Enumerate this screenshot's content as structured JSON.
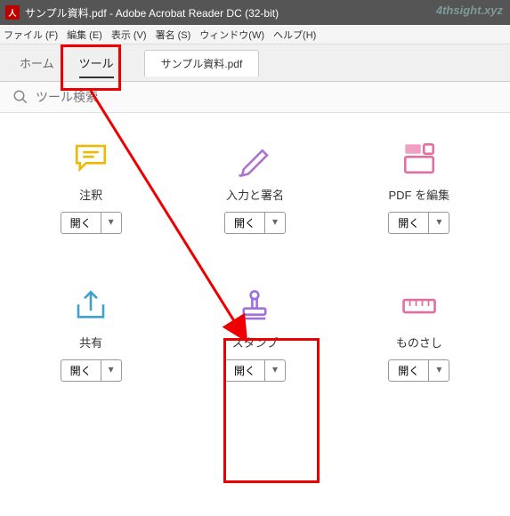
{
  "titlebar": {
    "text": "サンプル資料.pdf - Adobe Acrobat Reader DC (32-bit)"
  },
  "watermark": "4thsight.xyz",
  "menubar": {
    "file": "ファイル (F)",
    "edit": "編集 (E)",
    "view": "表示 (V)",
    "sign": "署名 (S)",
    "window": "ウィンドウ(W)",
    "help": "ヘルプ(H)"
  },
  "tabs": {
    "home": "ホーム",
    "tools": "ツール",
    "doc": "サンプル資料.pdf"
  },
  "search": {
    "placeholder": "ツール検索"
  },
  "open_label": "開く",
  "tools": {
    "comment": "注釈",
    "fill_sign": "入力と署名",
    "edit_pdf": "PDF を編集",
    "share": "共有",
    "stamp": "スタンプ",
    "measure": "ものさし"
  }
}
